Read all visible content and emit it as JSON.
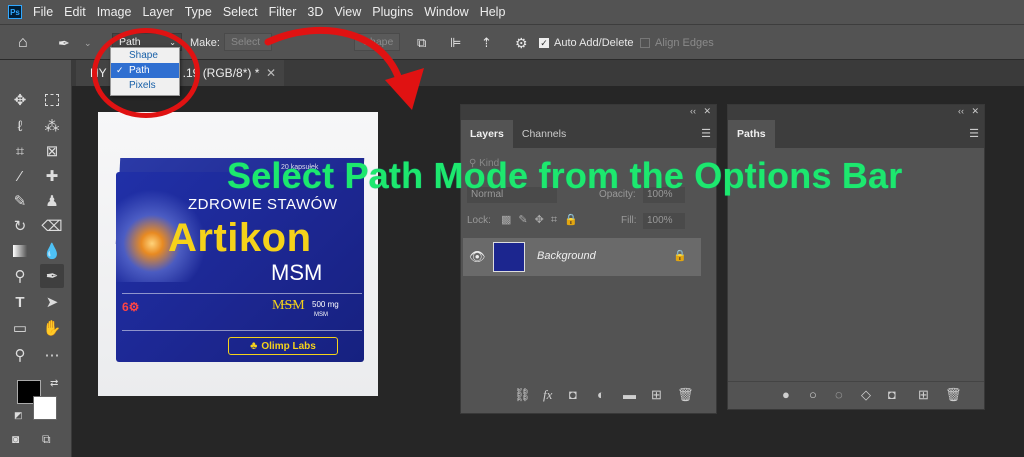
{
  "app": {
    "logo": "Ps"
  },
  "menu": [
    "File",
    "Edit",
    "Image",
    "Layer",
    "Type",
    "Select",
    "Filter",
    "3D",
    "View",
    "Plugins",
    "Window",
    "Help"
  ],
  "options": {
    "mode_value": "Path",
    "make_label": "Make:",
    "selection_btn": "Select",
    "shape_btn": "Shape",
    "auto_add_label": "Auto Add/Delete",
    "align_edges_label": "Align Edges"
  },
  "dropdown": {
    "items": [
      {
        "label": "Shape",
        "selected": false
      },
      {
        "label": "Path",
        "selected": true
      },
      {
        "label": "Pixels",
        "selected": false
      }
    ]
  },
  "document": {
    "tab_title_visible": "HY",
    "tab_title_rest": ".19 (RGB/8*) *"
  },
  "overlay": {
    "title": "Select Path Mode from the Options Bar"
  },
  "product": {
    "capsules": "20 kapsułek",
    "subtitle": "ZDROWIE STAWÓW",
    "brand": "Artikon",
    "brand_sub": "MSM",
    "dose": "500 mg",
    "dose_sub": "MSM",
    "maker": "Olimp Labs"
  },
  "layers_panel": {
    "tabs": [
      "Layers",
      "Channels"
    ],
    "kind": "Kind",
    "blend": "Normal",
    "opacity_label": "Opacity:",
    "opacity_value": "100%",
    "lock_label": "Lock:",
    "fill_label": "Fill:",
    "fill_value": "100%",
    "layers": [
      {
        "name": "Background",
        "visible": true,
        "locked": true
      }
    ]
  },
  "paths_panel": {
    "tabs": [
      "Paths"
    ]
  },
  "colors": {
    "accent": "#1de86e",
    "annotation": "#e01212"
  }
}
